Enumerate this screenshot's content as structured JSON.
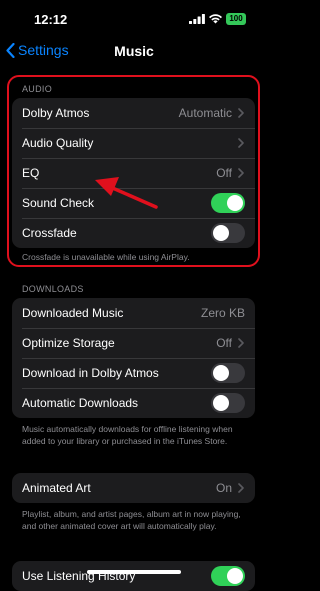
{
  "status": {
    "time": "12:12",
    "battery": "100"
  },
  "nav": {
    "back_label": "Settings",
    "title": "Music"
  },
  "audio": {
    "header": "AUDIO",
    "rows": [
      {
        "label": "Dolby Atmos",
        "value": "Automatic",
        "type": "chevron"
      },
      {
        "label": "Audio Quality",
        "value": "",
        "type": "chevron"
      },
      {
        "label": "EQ",
        "value": "Off",
        "type": "chevron"
      },
      {
        "label": "Sound Check",
        "type": "toggle",
        "on": true
      },
      {
        "label": "Crossfade",
        "type": "toggle",
        "on": false
      }
    ],
    "footer": "Crossfade is unavailable while using AirPlay."
  },
  "downloads": {
    "header": "DOWNLOADS",
    "rows": [
      {
        "label": "Downloaded Music",
        "value": "Zero KB"
      },
      {
        "label": "Optimize Storage",
        "value": "Off",
        "type": "chevron"
      },
      {
        "label": "Download in Dolby Atmos",
        "type": "toggle",
        "on": false
      },
      {
        "label": "Automatic Downloads",
        "type": "toggle",
        "on": false
      }
    ],
    "footer": "Music automatically downloads for offline listening when added to your library or purchased in the iTunes Store."
  },
  "animated": {
    "row": {
      "label": "Animated Art",
      "value": "On",
      "type": "chevron"
    },
    "footer": "Playlist, album, and artist pages, album art in now playing, and other animated cover art will automatically play."
  },
  "history": {
    "label": "Use Listening History",
    "on": true
  },
  "colors": {
    "accent": "#0a84ff",
    "toggle_on": "#30d158",
    "highlight": "#e0101d"
  }
}
